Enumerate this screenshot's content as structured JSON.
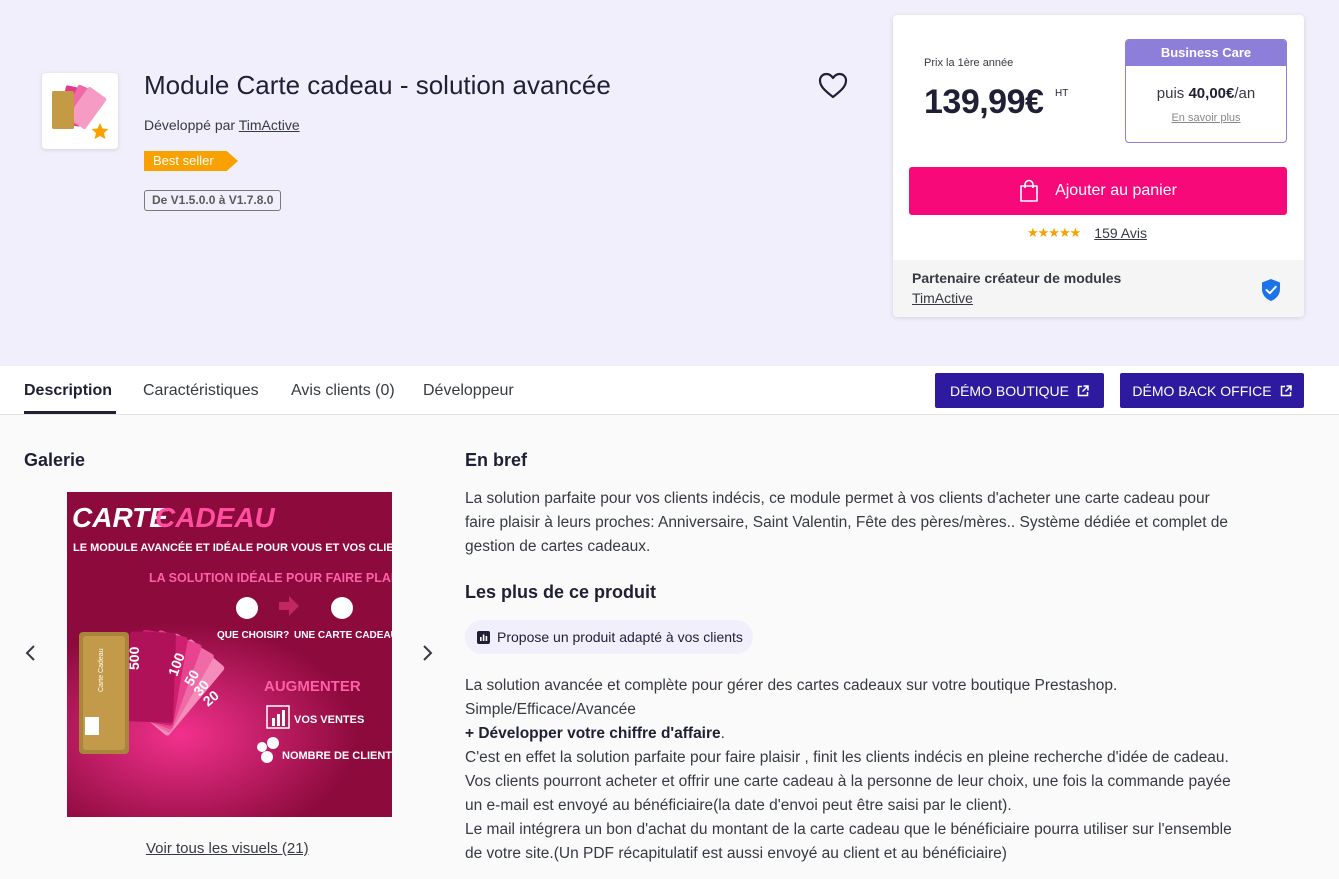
{
  "product": {
    "title": "Module Carte cadeau - solution avancée",
    "developed_by": "Développé par",
    "developer": "TimActive",
    "badge": "Best seller",
    "version": "De V1.5.0.0 à V1.7.8.0"
  },
  "pricing": {
    "label": "Prix la 1ère année",
    "price": "139,99€",
    "tax": "HT",
    "care_title": "Business Care",
    "care_prefix": "puis",
    "care_amount": "40,00€",
    "care_suffix": "/an",
    "care_link": "En savoir plus",
    "add_to_cart": "Ajouter au panier",
    "stars": "★★★★★",
    "reviews": "159 Avis",
    "partner_title": "Partenaire créateur de modules",
    "partner_name": "TimActive"
  },
  "tabs": {
    "description": "Description",
    "features": "Caractéristiques",
    "reviews": "Avis clients (0)",
    "developer": "Développeur",
    "demo_shop": "DÉMO BOUTIQUE",
    "demo_back": "DÉMO BACK OFFICE"
  },
  "gallery": {
    "title": "Galerie",
    "image": {
      "title_a": "CARTE",
      "title_b": "CADEAU",
      "subtitle": "LE MODULE AVANCÉE ET IDÉALE POUR VOUS ET VOS CLIENTS",
      "line1": "LA SOLUTION IDÉALE POUR FAIRE PLAISIR",
      "q1": "QUE CHOISIR?",
      "q2": "UNE CARTE CADEAU!",
      "augment": "AUGMENTER",
      "sales": "VOS VENTES",
      "clients": "NOMBRE DE CLIENTS",
      "card_label": "Carte Cadeau",
      "card_values": [
        "500",
        "100",
        "50",
        "30",
        "20"
      ]
    },
    "see_all": "Voir tous les visuels (21)"
  },
  "summary": {
    "title": "En bref",
    "lines": [
      "La solution parfaite pour vos clients indécis, ce module permet à vos clients d'acheter une carte cadeau pour",
      "faire plaisir à leurs proches: Anniversaire, Saint Valentin, Fête des pères/mères.. Système dédiée et complet de",
      "gestion de cartes cadeaux."
    ]
  },
  "highlights": {
    "title": "Les plus de ce produit",
    "chip": "Propose un produit adapté à vos clients"
  },
  "body": {
    "l1": "La solution avancée et complète pour gérer des cartes cadeaux sur votre boutique Prestashop.",
    "l2": "Simple/Efficace/Avancée",
    "l3_bold": "+ Développer votre chiffre d'affaire",
    "l3_end": ".",
    "l4": "C'est en effet la solution parfaite pour faire plaisir , finit les clients indécis en pleine recherche d'idée de cadeau.",
    "l5": "Vos clients pourront acheter et offrir une carte cadeau à la personne de leur choix, une fois la commande payée",
    "l6": "un e-mail est envoyé au bénéficiaire(la date d'envoi peut être saisi par le client).",
    "l7": "Le mail intégrera un bon d'achat du montant de la carte cadeau que le bénéficiaire pourra utiliser sur l'ensemble",
    "l8": "de votre site.(Un PDF récapitulatif est aussi envoyé au client et au bénéficiaire)"
  },
  "colors": {
    "hero_bg": "#f0effb",
    "accent_pink": "#f7097a",
    "demo_blue": "#2e1a9e",
    "care_purple": "#8d7fd9",
    "badge_orange": "#f8a101",
    "verified_blue": "#1a73e8"
  },
  "icons": {
    "heart": "heart-outline",
    "bag": "shopping-bag",
    "shield": "verified-shield",
    "external": "external-link",
    "chart": "bar-chart"
  }
}
